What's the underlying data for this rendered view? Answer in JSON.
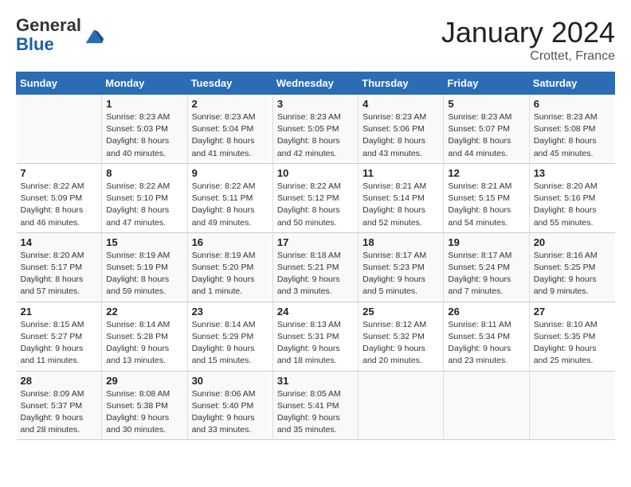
{
  "header": {
    "logo_general": "General",
    "logo_blue": "Blue",
    "month_title": "January 2024",
    "location": "Crottet, France"
  },
  "days_of_week": [
    "Sunday",
    "Monday",
    "Tuesday",
    "Wednesday",
    "Thursday",
    "Friday",
    "Saturday"
  ],
  "weeks": [
    [
      {
        "num": "",
        "info": ""
      },
      {
        "num": "1",
        "info": "Sunrise: 8:23 AM\nSunset: 5:03 PM\nDaylight: 8 hours\nand 40 minutes."
      },
      {
        "num": "2",
        "info": "Sunrise: 8:23 AM\nSunset: 5:04 PM\nDaylight: 8 hours\nand 41 minutes."
      },
      {
        "num": "3",
        "info": "Sunrise: 8:23 AM\nSunset: 5:05 PM\nDaylight: 8 hours\nand 42 minutes."
      },
      {
        "num": "4",
        "info": "Sunrise: 8:23 AM\nSunset: 5:06 PM\nDaylight: 8 hours\nand 43 minutes."
      },
      {
        "num": "5",
        "info": "Sunrise: 8:23 AM\nSunset: 5:07 PM\nDaylight: 8 hours\nand 44 minutes."
      },
      {
        "num": "6",
        "info": "Sunrise: 8:23 AM\nSunset: 5:08 PM\nDaylight: 8 hours\nand 45 minutes."
      }
    ],
    [
      {
        "num": "7",
        "info": "Sunrise: 8:22 AM\nSunset: 5:09 PM\nDaylight: 8 hours\nand 46 minutes."
      },
      {
        "num": "8",
        "info": "Sunrise: 8:22 AM\nSunset: 5:10 PM\nDaylight: 8 hours\nand 47 minutes."
      },
      {
        "num": "9",
        "info": "Sunrise: 8:22 AM\nSunset: 5:11 PM\nDaylight: 8 hours\nand 49 minutes."
      },
      {
        "num": "10",
        "info": "Sunrise: 8:22 AM\nSunset: 5:12 PM\nDaylight: 8 hours\nand 50 minutes."
      },
      {
        "num": "11",
        "info": "Sunrise: 8:21 AM\nSunset: 5:14 PM\nDaylight: 8 hours\nand 52 minutes."
      },
      {
        "num": "12",
        "info": "Sunrise: 8:21 AM\nSunset: 5:15 PM\nDaylight: 8 hours\nand 54 minutes."
      },
      {
        "num": "13",
        "info": "Sunrise: 8:20 AM\nSunset: 5:16 PM\nDaylight: 8 hours\nand 55 minutes."
      }
    ],
    [
      {
        "num": "14",
        "info": "Sunrise: 8:20 AM\nSunset: 5:17 PM\nDaylight: 8 hours\nand 57 minutes."
      },
      {
        "num": "15",
        "info": "Sunrise: 8:19 AM\nSunset: 5:19 PM\nDaylight: 8 hours\nand 59 minutes."
      },
      {
        "num": "16",
        "info": "Sunrise: 8:19 AM\nSunset: 5:20 PM\nDaylight: 9 hours\nand 1 minute."
      },
      {
        "num": "17",
        "info": "Sunrise: 8:18 AM\nSunset: 5:21 PM\nDaylight: 9 hours\nand 3 minutes."
      },
      {
        "num": "18",
        "info": "Sunrise: 8:17 AM\nSunset: 5:23 PM\nDaylight: 9 hours\nand 5 minutes."
      },
      {
        "num": "19",
        "info": "Sunrise: 8:17 AM\nSunset: 5:24 PM\nDaylight: 9 hours\nand 7 minutes."
      },
      {
        "num": "20",
        "info": "Sunrise: 8:16 AM\nSunset: 5:25 PM\nDaylight: 9 hours\nand 9 minutes."
      }
    ],
    [
      {
        "num": "21",
        "info": "Sunrise: 8:15 AM\nSunset: 5:27 PM\nDaylight: 9 hours\nand 11 minutes."
      },
      {
        "num": "22",
        "info": "Sunrise: 8:14 AM\nSunset: 5:28 PM\nDaylight: 9 hours\nand 13 minutes."
      },
      {
        "num": "23",
        "info": "Sunrise: 8:14 AM\nSunset: 5:29 PM\nDaylight: 9 hours\nand 15 minutes."
      },
      {
        "num": "24",
        "info": "Sunrise: 8:13 AM\nSunset: 5:31 PM\nDaylight: 9 hours\nand 18 minutes."
      },
      {
        "num": "25",
        "info": "Sunrise: 8:12 AM\nSunset: 5:32 PM\nDaylight: 9 hours\nand 20 minutes."
      },
      {
        "num": "26",
        "info": "Sunrise: 8:11 AM\nSunset: 5:34 PM\nDaylight: 9 hours\nand 23 minutes."
      },
      {
        "num": "27",
        "info": "Sunrise: 8:10 AM\nSunset: 5:35 PM\nDaylight: 9 hours\nand 25 minutes."
      }
    ],
    [
      {
        "num": "28",
        "info": "Sunrise: 8:09 AM\nSunset: 5:37 PM\nDaylight: 9 hours\nand 28 minutes."
      },
      {
        "num": "29",
        "info": "Sunrise: 8:08 AM\nSunset: 5:38 PM\nDaylight: 9 hours\nand 30 minutes."
      },
      {
        "num": "30",
        "info": "Sunrise: 8:06 AM\nSunset: 5:40 PM\nDaylight: 9 hours\nand 33 minutes."
      },
      {
        "num": "31",
        "info": "Sunrise: 8:05 AM\nSunset: 5:41 PM\nDaylight: 9 hours\nand 35 minutes."
      },
      {
        "num": "",
        "info": ""
      },
      {
        "num": "",
        "info": ""
      },
      {
        "num": "",
        "info": ""
      }
    ]
  ]
}
